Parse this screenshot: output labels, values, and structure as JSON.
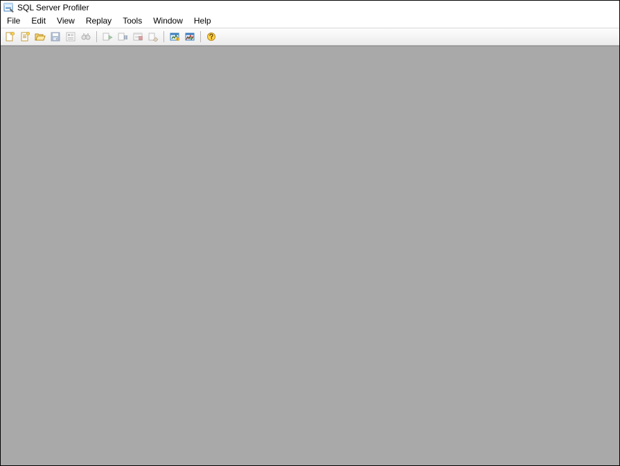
{
  "title": "SQL Server Profiler",
  "menu": {
    "file": "File",
    "edit": "Edit",
    "view": "View",
    "replay": "Replay",
    "tools": "Tools",
    "window": "Window",
    "help": "Help"
  },
  "toolbar": {
    "items": [
      {
        "name": "new-trace",
        "enabled": true
      },
      {
        "name": "new-template",
        "enabled": true
      },
      {
        "name": "open-file",
        "enabled": true
      },
      {
        "name": "save",
        "enabled": false
      },
      {
        "name": "properties",
        "enabled": false
      },
      {
        "name": "find",
        "enabled": false
      },
      {
        "sep": true
      },
      {
        "name": "run-trace",
        "enabled": false
      },
      {
        "name": "pause-trace",
        "enabled": false
      },
      {
        "name": "stop-trace",
        "enabled": false
      },
      {
        "name": "clear-trace-window",
        "enabled": false
      },
      {
        "sep": true
      },
      {
        "name": "database-tuning-advisor",
        "enabled": true
      },
      {
        "name": "performance-monitor",
        "enabled": true
      },
      {
        "sep": true
      },
      {
        "name": "help",
        "enabled": true
      }
    ]
  }
}
